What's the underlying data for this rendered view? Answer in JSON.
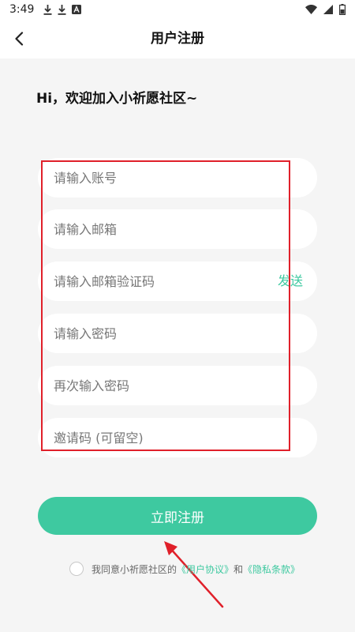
{
  "status_bar": {
    "time": "3:49",
    "icons": [
      "download-icon",
      "download-icon",
      "font-app-icon",
      "wifi-icon",
      "signal-icon",
      "battery-icon"
    ]
  },
  "app_bar": {
    "back_icon": "chevron-left-icon",
    "title": "用户注册"
  },
  "greeting": "Hi，欢迎加入小祈愿社区~",
  "form": {
    "account_placeholder": "请输入账号",
    "email_placeholder": "请输入邮箱",
    "email_code_placeholder": "请输入邮箱验证码",
    "send_label": "发送",
    "password_placeholder": "请输入密码",
    "confirm_password_placeholder": "再次输入密码",
    "invite_code_placeholder": "邀请码 (可留空)"
  },
  "register_button": "立即注册",
  "agreement": {
    "prefix": "我同意小祈愿社区的",
    "user_agreement": "《用户协议》",
    "and": "和",
    "privacy_policy": "《隐私条款》"
  },
  "colors": {
    "accent": "#3ec9a0",
    "highlight_box": "#e0202a",
    "background": "#f5f5f5"
  }
}
